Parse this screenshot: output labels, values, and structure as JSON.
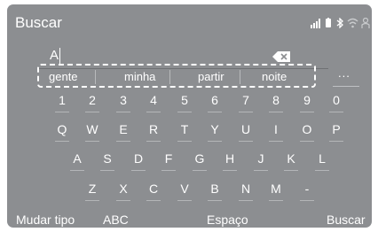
{
  "header": {
    "title": "Buscar",
    "status_icons": [
      "signal-bars-icon",
      "phone-battery-icon",
      "bluetooth-icon",
      "wifi-icon",
      "person-icon"
    ]
  },
  "search": {
    "value": "A",
    "backspace_icon": "backspace-icon"
  },
  "suggestions": [
    "gente",
    "minha",
    "partir",
    "noite"
  ],
  "more_label": "...",
  "keyboard": {
    "row1": [
      "1",
      "2",
      "3",
      "4",
      "5",
      "6",
      "7",
      "8",
      "9",
      "0"
    ],
    "row2": [
      "Q",
      "W",
      "E",
      "R",
      "T",
      "Y",
      "U",
      "I",
      "O",
      "P"
    ],
    "row3": [
      "A",
      "S",
      "D",
      "F",
      "G",
      "H",
      "J",
      "K",
      "L"
    ],
    "row4": [
      "Z",
      "X",
      "C",
      "V",
      "B",
      "N",
      "M",
      "-"
    ]
  },
  "bottom": {
    "change_type": "Mudar tipo",
    "abc": "ABC",
    "space": "Espaço",
    "search": "Buscar"
  },
  "colors": {
    "background": "#8c8e91",
    "text": "#ffffff"
  }
}
